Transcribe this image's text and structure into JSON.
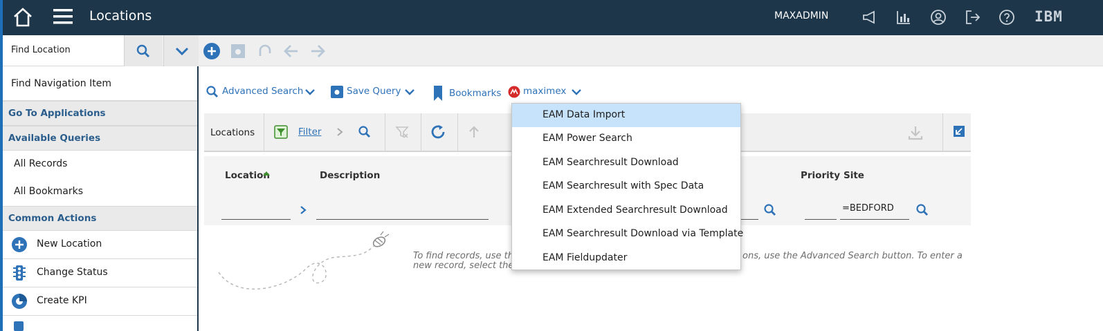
{
  "header": {
    "title": "Locations",
    "user": "MAXADMIN",
    "brand": "IBM",
    "bg_color": "#1d3649"
  },
  "find": {
    "placeholder": "Find Location"
  },
  "sidebar": {
    "find_nav": "Find Navigation Item",
    "goto_apps": "Go To Applications",
    "available_queries": "Available Queries",
    "queries": [
      "All Records",
      "All Bookmarks"
    ],
    "common_actions": "Common Actions",
    "actions": [
      {
        "label": "New Location",
        "icon": "plus-circle-icon"
      },
      {
        "label": "Change Status",
        "icon": "traffic-light-icon"
      },
      {
        "label": "Create KPI",
        "icon": "kpi-gauge-icon"
      }
    ]
  },
  "querybar": {
    "advanced_search": "Advanced Search",
    "save_query": "Save Query",
    "bookmarks": "Bookmarks",
    "maximex": "maximex"
  },
  "list": {
    "tab_label": "Locations",
    "filter_label": "Filter",
    "columns": {
      "location": "Location",
      "description": "Description",
      "priority": "Priority",
      "site": "Site"
    },
    "site_filter_value": "=BEDFORD"
  },
  "hint": {
    "line1_left": "To find records, use the",
    "line1_right": "ons, use the Advanced Search button. To enter a",
    "line2_left": "new record, select the I"
  },
  "dropdown": {
    "items": [
      "EAM Data Import",
      "EAM Power Search",
      "EAM Searchresult Download",
      "EAM Searchresult with Spec Data",
      "EAM Extended Searchresult Download",
      "EAM Searchresult Download via Template",
      "EAM Fieldupdater"
    ],
    "selected_index": 0
  },
  "colors": {
    "accent": "#2e72b8",
    "sidebar_head_text": "#2b5e8c",
    "selected_item_bg": "#c6e3fb"
  }
}
